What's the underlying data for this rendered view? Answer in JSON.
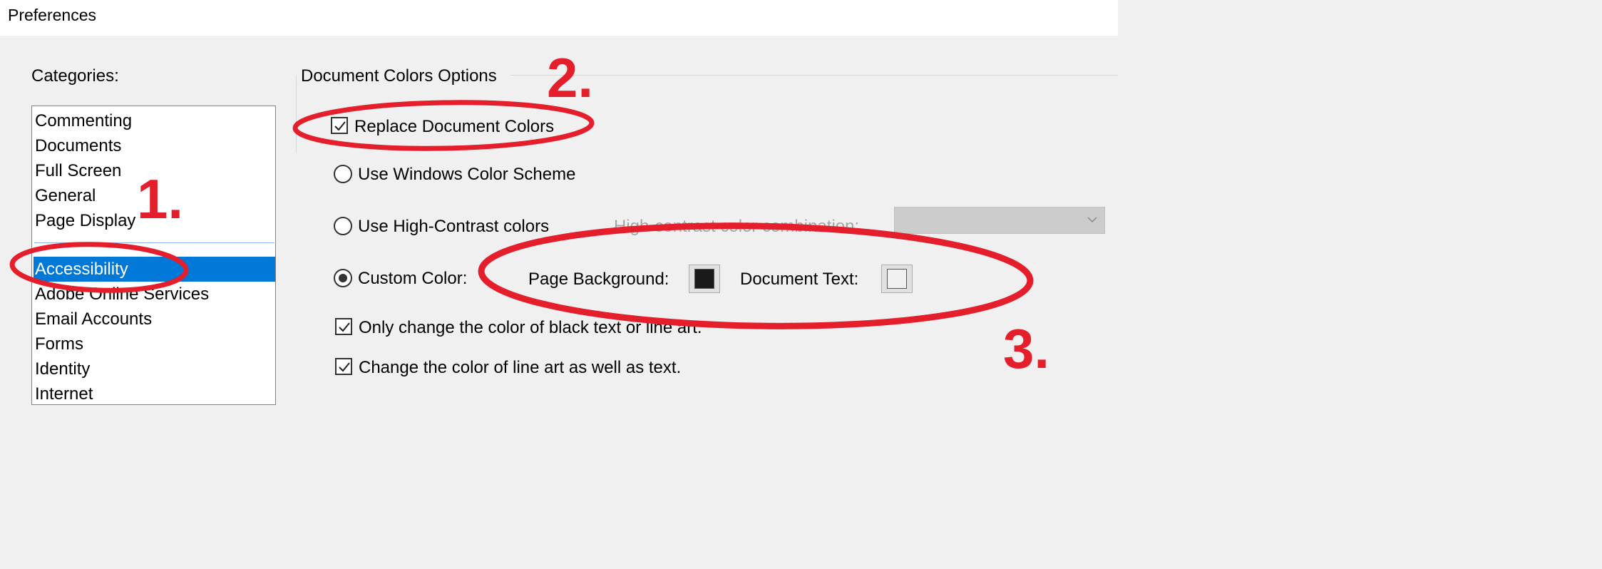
{
  "window": {
    "title": "Preferences"
  },
  "categories": {
    "label": "Categories:",
    "top_items": [
      "Commenting",
      "Documents",
      "Full Screen",
      "General",
      "Page Display"
    ],
    "selected": "Accessibility",
    "bottom_items": [
      "Adobe Online Services",
      "Email Accounts",
      "Forms",
      "Identity",
      "Internet"
    ]
  },
  "document_colors": {
    "group_title": "Document Colors Options",
    "replace_colors": {
      "label": "Replace Document Colors",
      "checked": true
    },
    "windows_scheme": {
      "label": "Use Windows Color Scheme",
      "selected": false
    },
    "high_contrast": {
      "label": "Use High-Contrast colors",
      "selected": false
    },
    "high_contrast_combo": {
      "label": "High-contrast color combination:",
      "value": ""
    },
    "custom_color": {
      "label": "Custom Color:",
      "selected": true
    },
    "page_background": {
      "label": "Page Background:",
      "color": "#1a1a1a"
    },
    "document_text": {
      "label": "Document Text:",
      "color": "#f0f0f0"
    },
    "only_black_text": {
      "label": "Only change the color of black text or line art.",
      "checked": true
    },
    "line_art": {
      "label": "Change the color of line art as well as text.",
      "checked": true
    }
  },
  "annotations": {
    "color": "#e41e2b",
    "step1": "1.",
    "step2": "2.",
    "step3": "3."
  }
}
